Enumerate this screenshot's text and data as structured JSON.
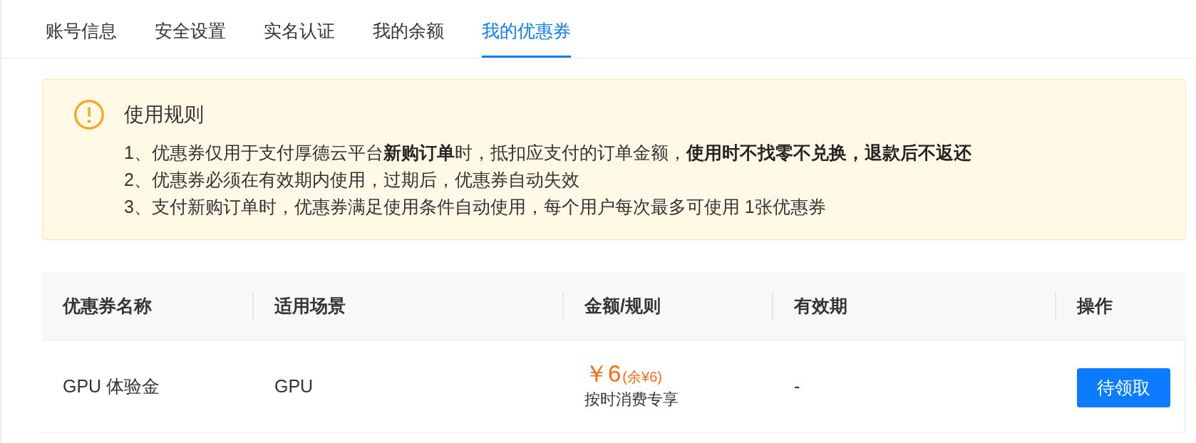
{
  "tabs": [
    {
      "label": "账号信息",
      "selected": false
    },
    {
      "label": "安全设置",
      "selected": false
    },
    {
      "label": "实名认证",
      "selected": false
    },
    {
      "label": "我的余额",
      "selected": false
    },
    {
      "label": "我的优惠券",
      "selected": true
    }
  ],
  "notice": {
    "title": "使用规则",
    "rules": [
      "1、优惠券仅用于支付厚德云平台**新购订单**时，抵扣应支付的订单金额，**使用时不找零不兑换，退款后不返还**",
      "2、优惠券必须在有效期内使用，过期后，优惠券自动失效",
      "3、支付新购订单时，优惠券满足使用条件自动使用，每个用户每次最多可使用 1张优惠券"
    ]
  },
  "table": {
    "columns": [
      "优惠券名称",
      "适用场景",
      "金额/规则",
      "有效期",
      "操作"
    ],
    "rows": [
      {
        "name": "GPU 体验金",
        "scene": "GPU",
        "amount": "￥6",
        "remaining": "(余¥6)",
        "rule": "按时消费专享",
        "validity": "-",
        "action": "待领取"
      }
    ]
  }
}
